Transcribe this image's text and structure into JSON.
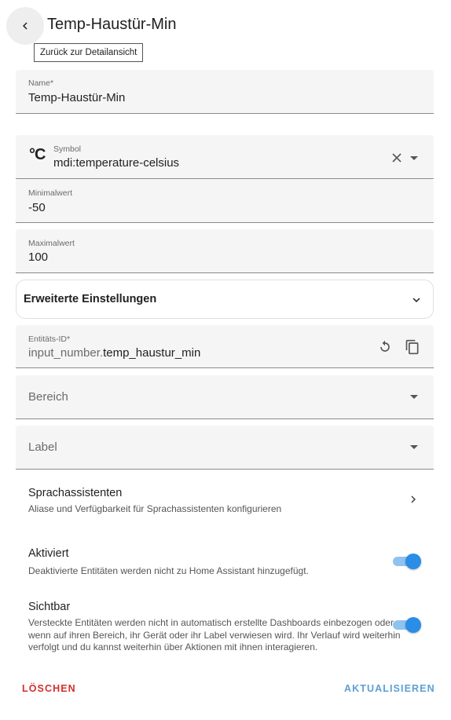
{
  "header": {
    "title": "Temp-Haustür-Min",
    "back_tooltip": "Zurück zur Detailansicht"
  },
  "fields": {
    "name": {
      "label": "Name*",
      "value": "Temp-Haustür-Min"
    },
    "symbol": {
      "label": "Symbol",
      "value": "mdi:temperature-celsius",
      "icon_glyph": "°C"
    },
    "min": {
      "label": "Minimalwert",
      "value": "-50"
    },
    "max": {
      "label": "Maximalwert",
      "value": "100"
    }
  },
  "advanced": {
    "title": "Erweiterte Einstellungen"
  },
  "entity_id": {
    "label": "Entitäts-ID*",
    "prefix": "input_number.",
    "value": "temp_haustur_min"
  },
  "area": {
    "placeholder": "Bereich"
  },
  "label": {
    "placeholder": "Label"
  },
  "voice": {
    "title": "Sprachassistenten",
    "subtitle": "Aliase und Verfügbarkeit für Sprachassistenten konfigurieren"
  },
  "enabled": {
    "title": "Aktiviert",
    "subtitle": "Deaktivierte Entitäten werden nicht zu Home Assistant hinzugefügt.",
    "on": true
  },
  "visible": {
    "title": "Sichtbar",
    "subtitle": "Versteckte Entitäten werden nicht in automatisch erstellte Dashboards einbezogen oder wenn auf ihren Bereich, ihr Gerät oder ihr Label verwiesen wird. Ihr Verlauf wird weiterhin verfolgt und du kannst weiterhin über Aktionen mit ihnen interagieren.",
    "on": true
  },
  "actions": {
    "delete_label": "LÖSCHEN",
    "update_label": "AKTUALISIEREN"
  },
  "colors": {
    "accent": "#2a8de6",
    "danger": "#d32f2f",
    "update": "#5b9fd6"
  }
}
